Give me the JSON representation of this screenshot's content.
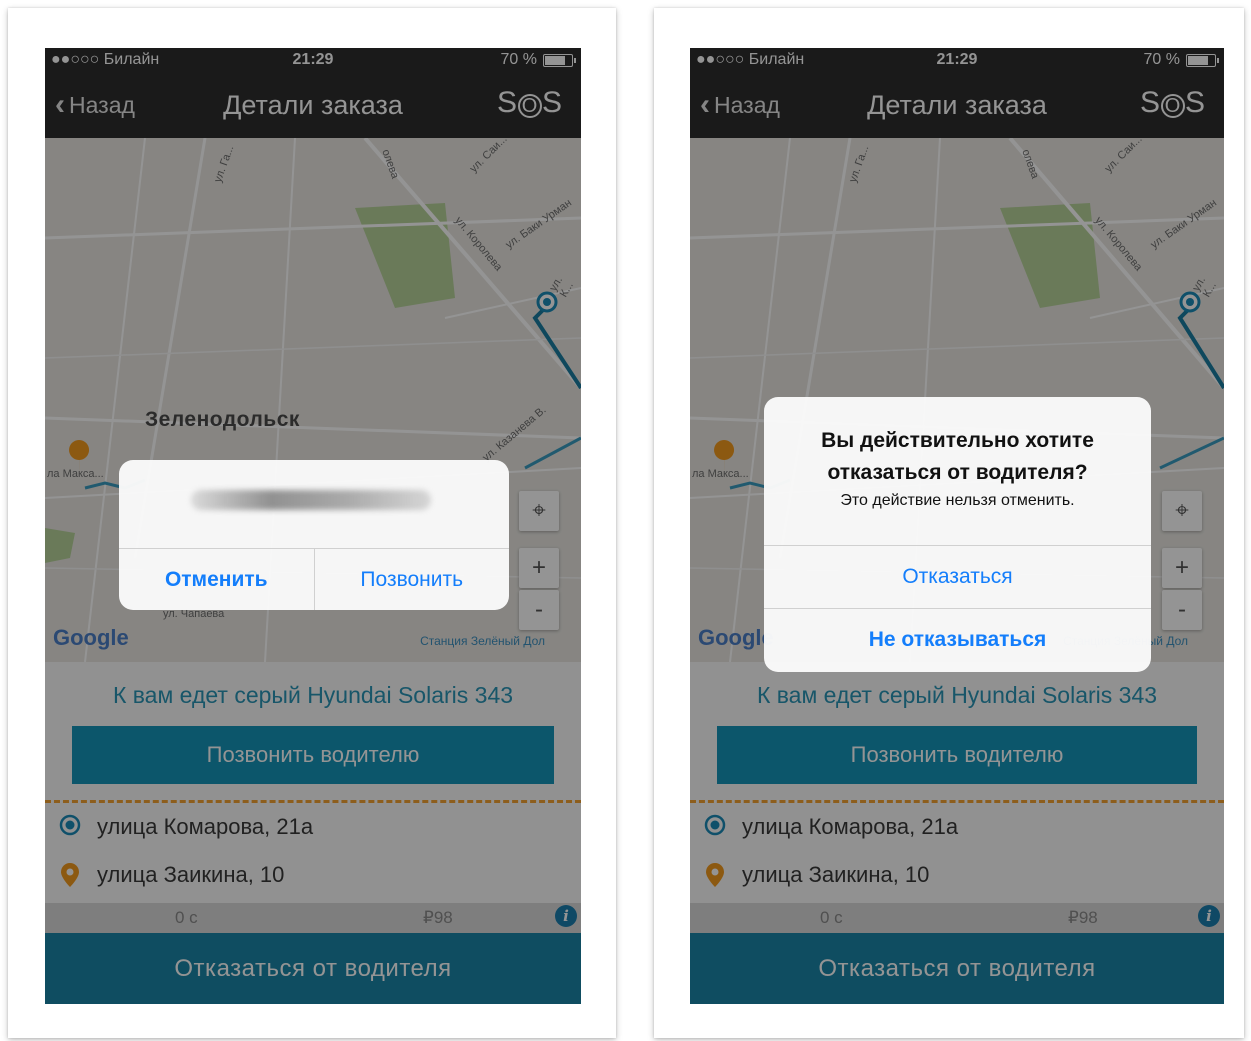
{
  "status_bar": {
    "carrier": "●●○○○ Билайн",
    "time": "21:29",
    "battery": "70 %"
  },
  "nav": {
    "back_label": "Назад",
    "title": "Детали заказа",
    "sos_label": "SOS"
  },
  "map": {
    "city": "Зеленодольск",
    "street_labels": [
      "ул. Га...",
      "ул. Саи...",
      "олева",
      "ул. Баки Урман",
      "ул. Королева",
      "ул. К...",
      "ул. Казанева В.",
      "ул. Чапаева",
      "ла Макса..."
    ],
    "provider": "Google",
    "station": "Станция Зелёный Дол",
    "locate_icon": "crosshair-icon",
    "zoom_in": "+",
    "zoom_out": "-"
  },
  "order": {
    "car_text": "К вам едет серый  Hyundai  Solaris 343",
    "call_driver_button": "Позвонить водителю",
    "from_address": "улица Комарова, 21а",
    "to_address": "улица Заикина, 10",
    "duration": "0 с",
    "price": "₽98",
    "refuse_button": "Отказаться от водителя"
  },
  "call_alert": {
    "cancel_button": "Отменить",
    "call_button": "Позвонить"
  },
  "refuse_alert": {
    "title": "Вы действительно хотите отказаться от водителя?",
    "message": "Это действие нельзя отменить.",
    "confirm_button": "Отказаться",
    "keep_button": "Не отказываться"
  },
  "colors": {
    "accent": "#1695b8",
    "ios_blue": "#147efb",
    "dash_orange": "#f3a232",
    "nav_dark": "#2e2e2e"
  }
}
